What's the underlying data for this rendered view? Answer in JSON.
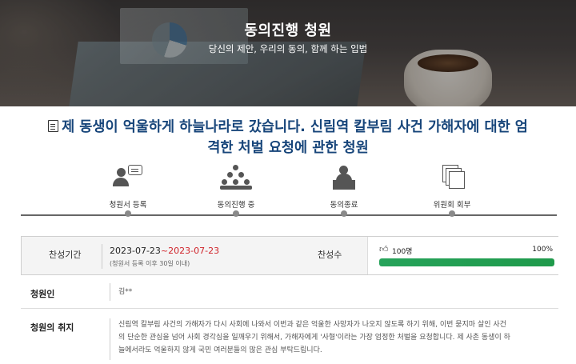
{
  "hero": {
    "title": "동의진행 청원",
    "subtitle": "당신의 제안, 우리의 동의, 함께 하는 입법"
  },
  "petition": {
    "title": "제 동생이 억울하게 하늘나라로 갔습니다. 신림역 칼부림 사건 가해자에 대한 엄격한 처벌 요청에 관한 청원"
  },
  "steps": [
    {
      "label": "청원서 등록",
      "icon": "petition-register-icon"
    },
    {
      "label": "동의진행 중",
      "icon": "group-agree-icon"
    },
    {
      "label": "동의종료",
      "icon": "presenter-desk-icon"
    },
    {
      "label": "위원회 회부",
      "icon": "document-stack-icon"
    }
  ],
  "info": {
    "period_label": "찬성기간",
    "period_start": "2023-07-23",
    "period_sep": "~",
    "period_end": "2023-07-23",
    "period_note": "(청원서 등록 이후 30일 이내)",
    "agree_label": "찬성수",
    "agree_count": "100명",
    "agree_percent_text": "100%",
    "agree_progress": 1.0,
    "colors": {
      "period_end": "#d0232a",
      "progress": "#26a35a",
      "title": "#17457a"
    }
  },
  "petitioner": {
    "label": "청원인",
    "value": "김**"
  },
  "purpose": {
    "label": "청원의 취지",
    "lines": [
      "신림역 칼부림 사건의 가해자가 다시 사회에 나와서 이번과 같은 억울한 사망자가 나오지 않도록 하기 위해, 이번 묻지마 살인 사건",
      "의 단순한 관심을 넘어 사회 경각심을 일깨우기 위해서, 가해자에게 '사형'이라는 가장 엄정한 처벌을 요청합니다. 제 사촌 동생이 하",
      "늘에서라도 억울하지 않게 국민 여러분들의 많은 관심 부탁드립니다."
    ]
  }
}
